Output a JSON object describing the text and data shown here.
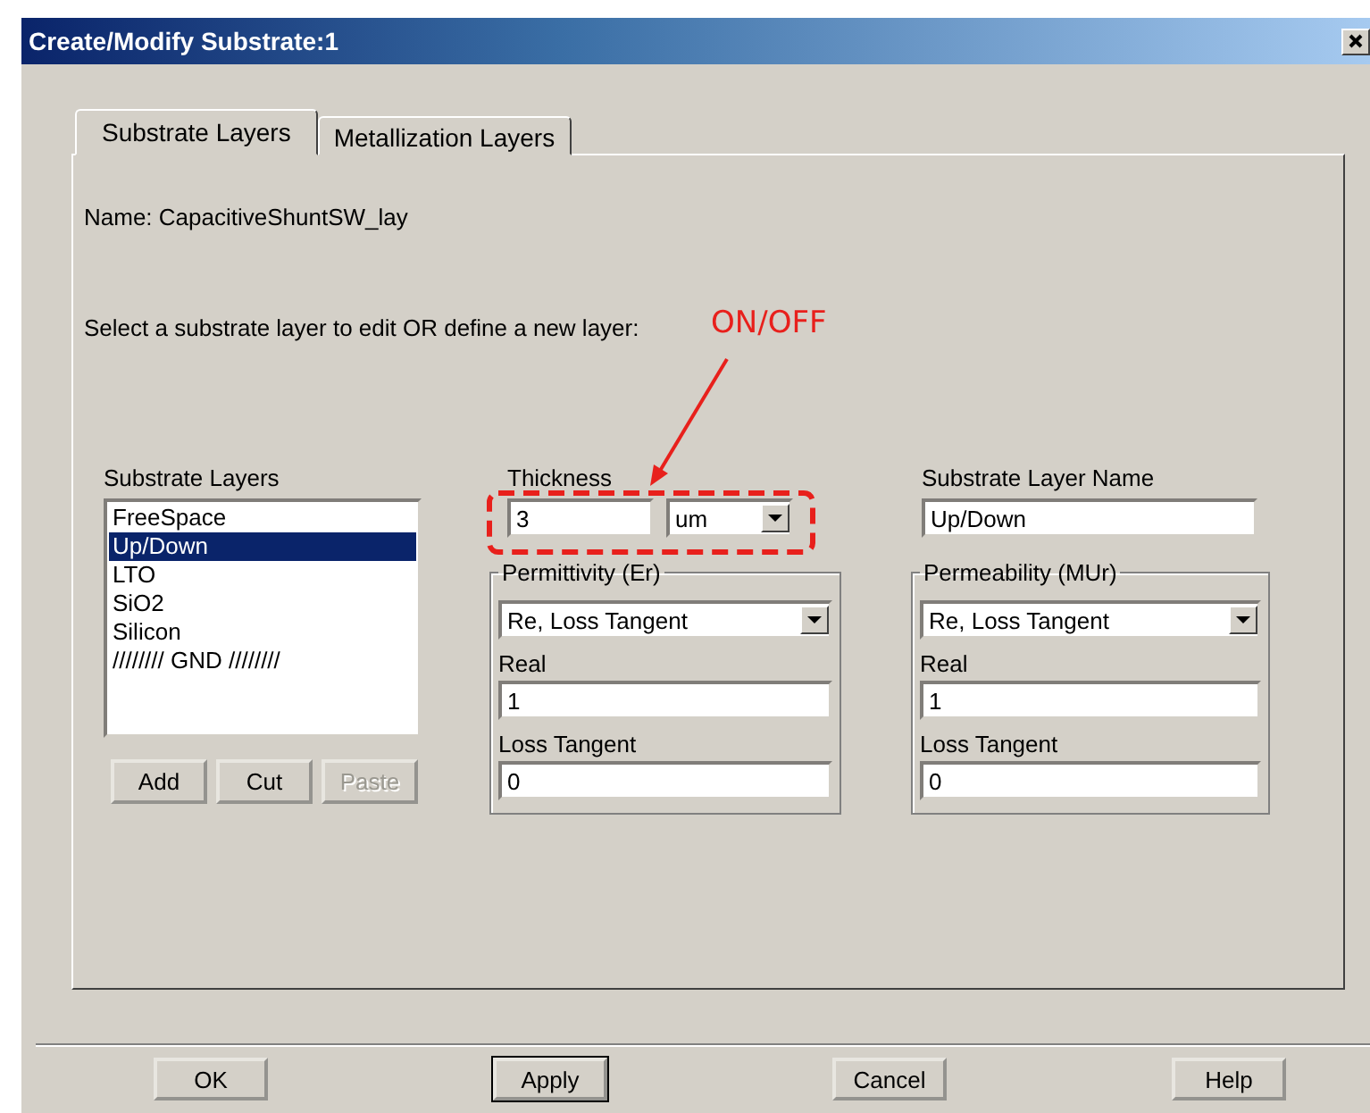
{
  "window": {
    "title": "Create/Modify Substrate:1"
  },
  "tabs": [
    {
      "label": "Substrate Layers",
      "selected": true
    },
    {
      "label": "Metallization Layers",
      "selected": false
    }
  ],
  "name_label": "Name: CapacitiveShuntSW_lay",
  "instruction": "Select a substrate layer to edit OR define a new layer:",
  "substrate_layers": {
    "label": "Substrate Layers",
    "items": [
      {
        "label": "FreeSpace",
        "selected": false
      },
      {
        "label": "Up/Down",
        "selected": true
      },
      {
        "label": "LTO",
        "selected": false
      },
      {
        "label": "SiO2",
        "selected": false
      },
      {
        "label": "Silicon",
        "selected": false
      },
      {
        "label": "//////// GND ////////",
        "selected": false
      }
    ],
    "buttons": [
      {
        "label": "Add",
        "disabled": false
      },
      {
        "label": "Cut",
        "disabled": false
      },
      {
        "label": "Paste",
        "disabled": true
      }
    ]
  },
  "thickness": {
    "label": "Thickness",
    "value": "3",
    "unit": "um"
  },
  "permittivity": {
    "title": "Permittivity (Er)",
    "mode": "Re, Loss Tangent",
    "real_label": "Real",
    "real": "1",
    "loss_label": "Loss Tangent",
    "loss": "0"
  },
  "layer_name": {
    "label": "Substrate Layer Name",
    "value": "Up/Down"
  },
  "permeability": {
    "title": "Permeability (MUr)",
    "mode": "Re, Loss Tangent",
    "real_label": "Real",
    "real": "1",
    "loss_label": "Loss Tangent",
    "loss": "0"
  },
  "annotation": {
    "text": "ON/OFF"
  },
  "buttons": [
    {
      "label": "OK",
      "default": false
    },
    {
      "label": "Apply",
      "default": true
    },
    {
      "label": "Cancel",
      "default": false
    },
    {
      "label": "Help",
      "default": false
    }
  ]
}
